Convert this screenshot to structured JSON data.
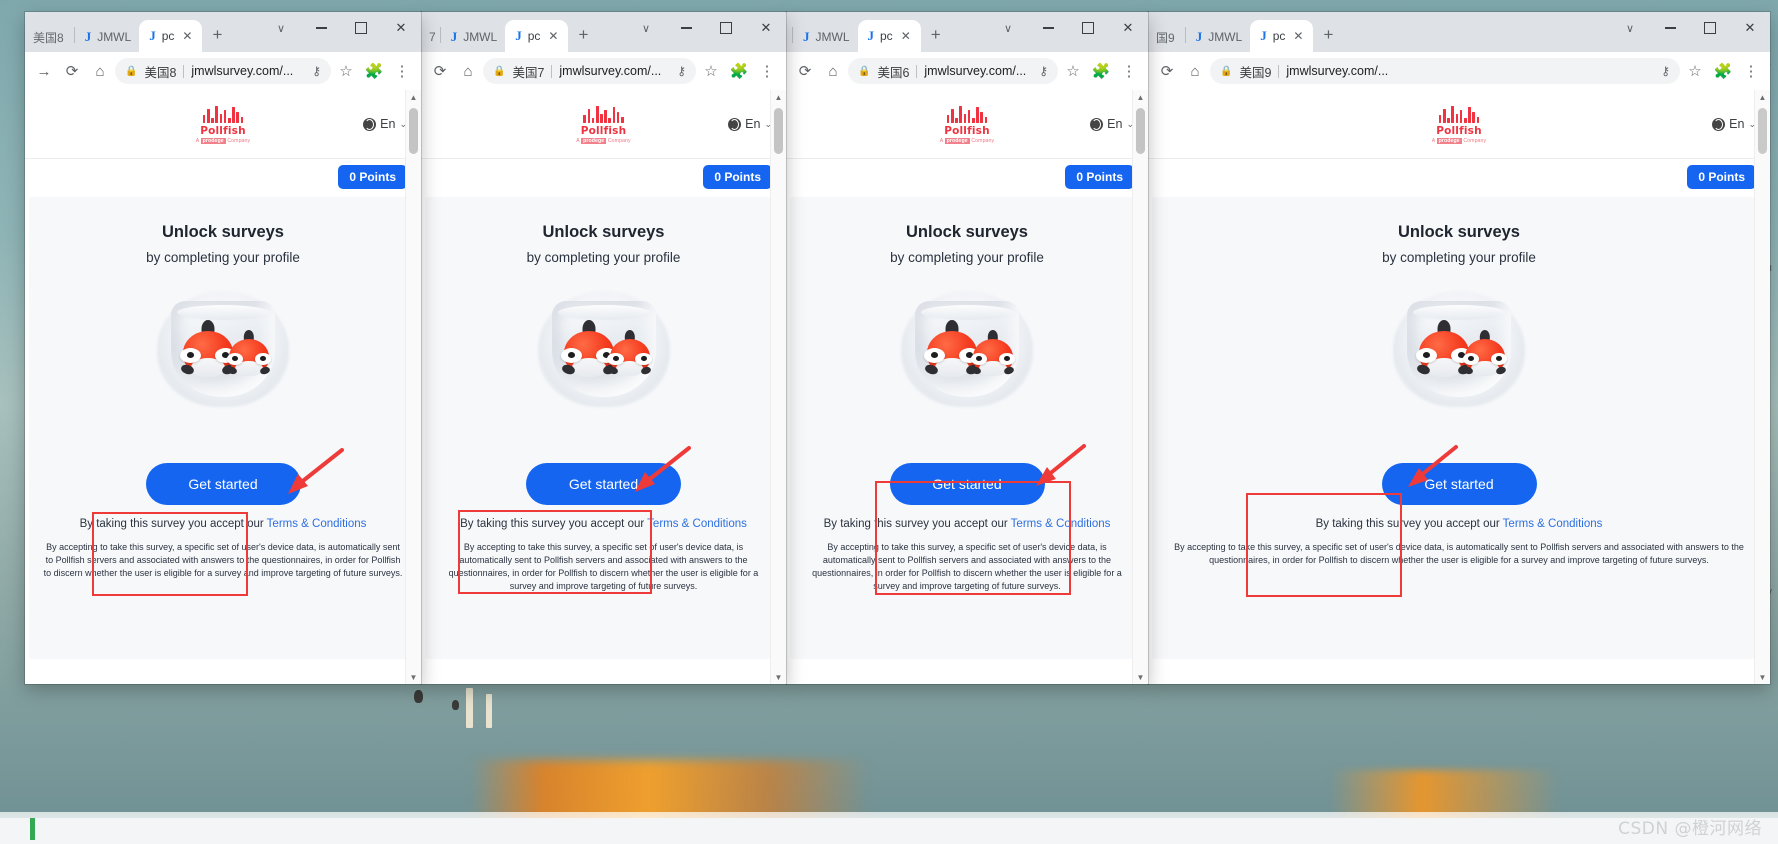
{
  "desktop": {
    "watermark": "CSDN @橙河网络"
  },
  "browser": {
    "toolbar_icons": {
      "back": "back-arrow-icon",
      "forward": "forward-arrow-icon",
      "reload": "reload-icon",
      "home": "home-icon",
      "lock": "lock-icon",
      "key": "key-icon",
      "bookmark": "star-icon",
      "extensions": "puzzle-icon",
      "menu": "three-dot-menu-icon"
    },
    "newtab_label": "+",
    "close_label": "✕"
  },
  "windows": [
    {
      "id": "win-1",
      "partial_tab_label": "美国8",
      "tabs": [
        {
          "favicon": "J",
          "label": "JMWL",
          "active": false
        },
        {
          "favicon": "J",
          "label": "pc",
          "active": true,
          "closable": true
        }
      ],
      "omnibox": {
        "site": "美国8",
        "url": "jmwlsurvey.com/...",
        "lock": "🔒"
      },
      "has_back_arrow": true
    },
    {
      "id": "win-2",
      "partial_tab_label": "7",
      "tabs": [
        {
          "favicon": "J",
          "label": "JMWL",
          "active": false
        },
        {
          "favicon": "J",
          "label": "pc",
          "active": true,
          "closable": true
        }
      ],
      "omnibox": {
        "site": "美国7",
        "url": "jmwlsurvey.com/...",
        "lock": "🔒"
      },
      "has_back_arrow": false
    },
    {
      "id": "win-3",
      "partial_tab_label": "",
      "tabs": [
        {
          "favicon": "J",
          "label": "JMWL",
          "active": false
        },
        {
          "favicon": "J",
          "label": "pc",
          "active": true,
          "closable": true
        }
      ],
      "omnibox": {
        "site": "美国6",
        "url": "jmwlsurvey.com/...",
        "lock": "🔒"
      },
      "has_back_arrow": false
    },
    {
      "id": "win-4",
      "partial_tab_label": "国9",
      "tabs": [
        {
          "favicon": "J",
          "label": "JMWL",
          "active": false
        },
        {
          "favicon": "J",
          "label": "pc",
          "active": true,
          "closable": true
        }
      ],
      "omnibox": {
        "site": "美国9",
        "url": "jmwlsurvey.com/...",
        "lock": "🔒"
      },
      "has_back_arrow": false
    }
  ],
  "page": {
    "logo": {
      "name": "Pollfish",
      "tagline_prefix": "A",
      "tagline_brand": "prodege",
      "tagline_suffix": "Company"
    },
    "language": {
      "label": "En",
      "icon": "globe-icon",
      "caret": "⌄"
    },
    "points_badge": "0 Points",
    "headline": "Unlock surveys",
    "subheadline": "by completing your profile",
    "illustration": "fishbowl-with-two-fish",
    "cta_label": "Get started",
    "terms_prefix": "By taking this survey you accept our ",
    "terms_link": "Terms & Conditions",
    "disclaimer": "By accepting to take this survey, a specific set of user's device data, is automatically sent to Pollfish servers and associated with answers to the questionnaires, in order for Pollfish to discern whether the user is eligible for a survey and improve targeting of future surveys.",
    "colors": {
      "brand_red": "#ef3340",
      "cta_blue": "#1565f0",
      "link_blue": "#2d6fe0",
      "annotation_red": "#ef3a3a",
      "card_bg": "#f7f8fa"
    }
  },
  "annotations": {
    "rect_label": "highlight-rectangle",
    "arrow_label": "pointer-arrow"
  }
}
